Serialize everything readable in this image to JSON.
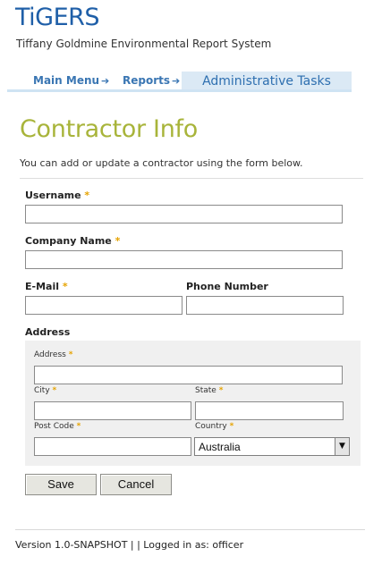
{
  "app": {
    "logo": "TiGERS",
    "subtitle": "Tiffany Goldmine Environmental Report System"
  },
  "nav": {
    "items": [
      {
        "label": "Main Menu",
        "arrow": "➔"
      },
      {
        "label": "Reports",
        "arrow": "➔"
      }
    ],
    "active": "Administrative Tasks"
  },
  "page": {
    "title": "Contractor Info",
    "intro": "You can add or update a contractor using the form below."
  },
  "form": {
    "required_mark": "*",
    "username": {
      "label": "Username",
      "value": ""
    },
    "company": {
      "label": "Company Name",
      "value": ""
    },
    "email": {
      "label": "E-Mail",
      "value": ""
    },
    "phone": {
      "label": "Phone Number",
      "value": ""
    },
    "address_section": "Address",
    "address": {
      "label": "Address",
      "value": ""
    },
    "city": {
      "label": "City",
      "value": ""
    },
    "state": {
      "label": "State",
      "value": ""
    },
    "postcode": {
      "label": "Post Code",
      "value": ""
    },
    "country": {
      "label": "Country",
      "value": "Australia"
    },
    "save_label": "Save",
    "cancel_label": "Cancel"
  },
  "footer": {
    "text": "Version 1.0-SNAPSHOT | | Logged in as: officer"
  },
  "colors": {
    "brand": "#1f5fa8",
    "title_green": "#a8b43a",
    "required": "#e6a300",
    "nav_active_bg": "#dbe9f5"
  }
}
